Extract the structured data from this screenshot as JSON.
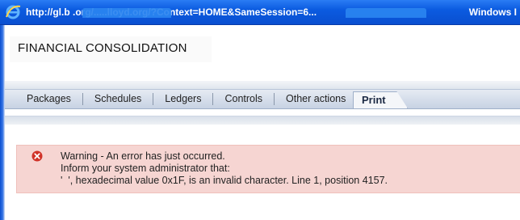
{
  "window": {
    "title_url": "http://gl.b              .org/.....lloyd.org/?Context=HOME&SameSession=6...",
    "app_name": "Windows I",
    "icon": "internet-explorer-icon"
  },
  "page": {
    "title": "FINANCIAL CONSOLIDATION"
  },
  "tabs": [
    {
      "label": "Packages"
    },
    {
      "label": "Schedules"
    },
    {
      "label": "Ledgers"
    },
    {
      "label": "Controls"
    },
    {
      "label": "Other actions"
    }
  ],
  "active_tab": {
    "label": "Print"
  },
  "alert": {
    "icon": "error-icon",
    "line1": "Warning - An error has just occurred.",
    "line2": "Inform your system administrator that:",
    "line3": "'  ', hexadecimal value 0x1F, is an invalid character. Line 1, position 4157.",
    "color": "#f6d5d2"
  },
  "colors": {
    "titlebar": "#0b5be0",
    "tabbar": "#c7d2e3",
    "error_icon": "#d03228"
  }
}
